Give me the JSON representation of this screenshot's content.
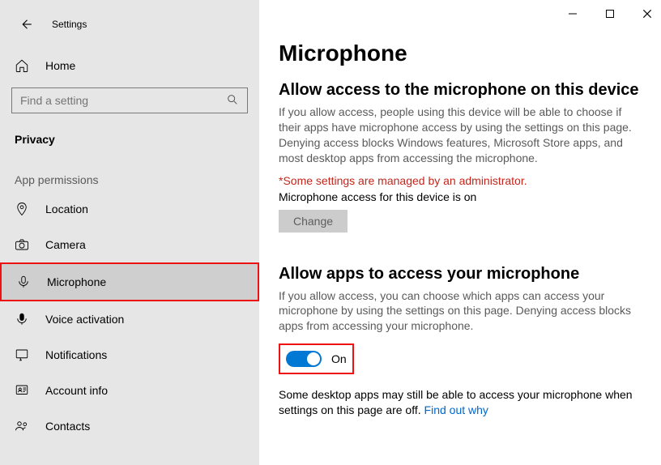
{
  "app_title": "Settings",
  "home_label": "Home",
  "search_placeholder": "Find a setting",
  "category_label": "Privacy",
  "section_header": "App permissions",
  "nav": {
    "location": "Location",
    "camera": "Camera",
    "microphone": "Microphone",
    "voice": "Voice activation",
    "notifications": "Notifications",
    "account": "Account info",
    "contacts": "Contacts"
  },
  "main": {
    "title": "Microphone",
    "section1": {
      "title": "Allow access to the microphone on this device",
      "desc": "If you allow access, people using this device will be able to choose if their apps have microphone access by using the settings on this page. Denying access blocks Windows features, Microsoft Store apps, and most desktop apps from accessing the microphone.",
      "admin_note": "*Some settings are managed by an administrator.",
      "status": "Microphone access for this device is on",
      "change_btn": "Change"
    },
    "section2": {
      "title": "Allow apps to access your microphone",
      "desc": "If you allow access, you can choose which apps can access your microphone by using the settings on this page. Denying access blocks apps from accessing your microphone.",
      "toggle_label": "On",
      "footnote_pre": "Some desktop apps may still be able to access your microphone when settings on this page are off. ",
      "footnote_link": "Find out why"
    }
  }
}
